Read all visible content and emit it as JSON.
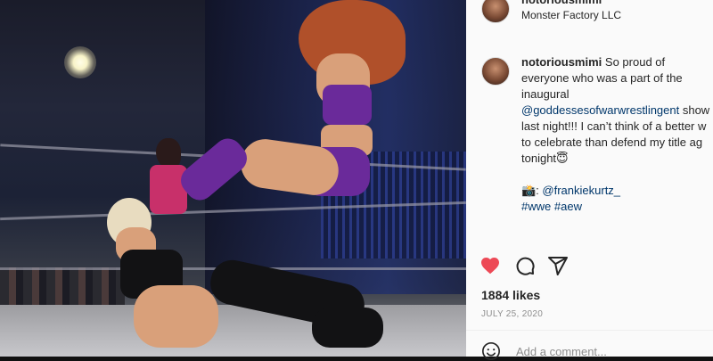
{
  "post": {
    "username": "notoriousmimi",
    "location": "Monster Factory LLC",
    "caption": {
      "author": "notoriousmimi",
      "line1": "So proud of",
      "line2": "everyone who was a part of the",
      "line3": "inaugural",
      "mention": "@goddessesofwarwrestlingent",
      "line4_tail": " show",
      "line5": "last night!!! I can’t think of a better w",
      "line6": "to celebrate than defend my title ag",
      "line7": "tonight😇",
      "credit_prefix": "📸: ",
      "credit": "@frankiekurtz_",
      "hashtag1": "#wwe",
      "hashtag2": "#aew"
    },
    "likes": "1884 likes",
    "date": "JULY 25, 2020"
  },
  "actions": {
    "like_icon": "heart-filled-icon",
    "comment_icon": "comment-icon",
    "share_icon": "share-icon"
  },
  "comment": {
    "placeholder": "Add a comment..."
  },
  "colors": {
    "like": "#ed4956",
    "link": "#00376b",
    "panel_bg": "#fafafa"
  }
}
